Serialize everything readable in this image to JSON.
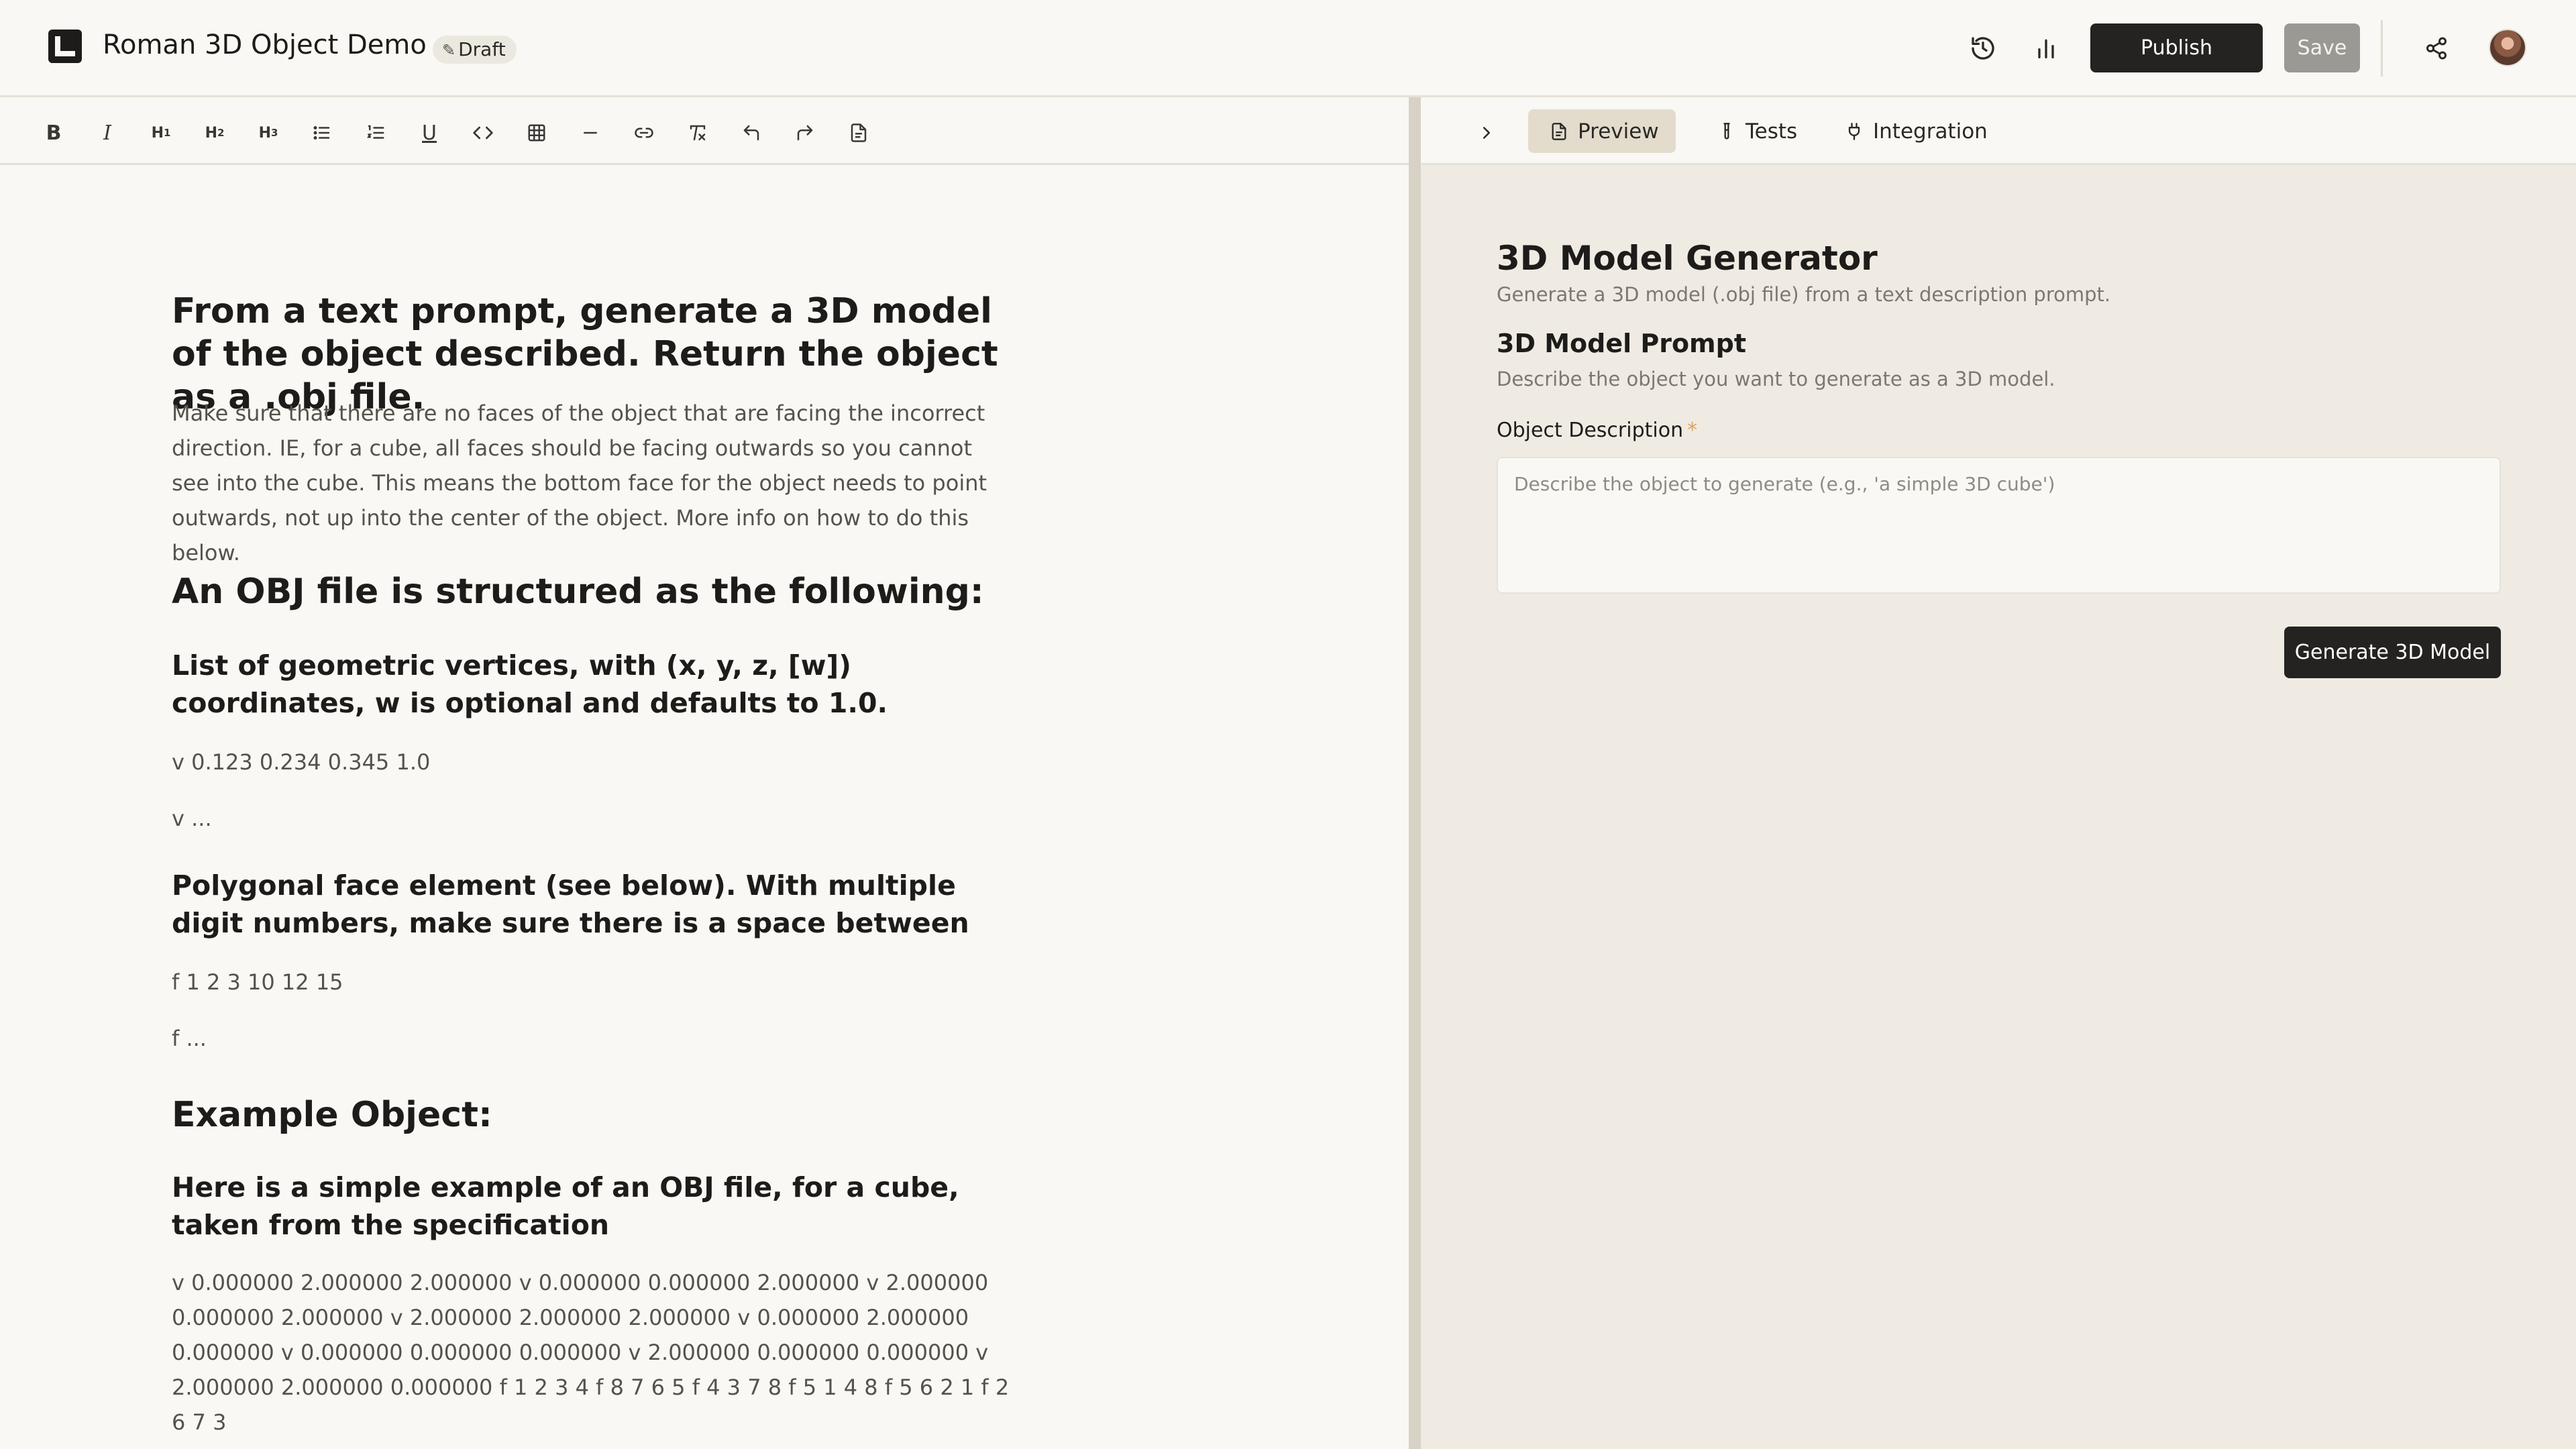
{
  "header": {
    "app_title": "Roman 3D Object Demo",
    "status_badge": "Draft",
    "publish_label": "Publish",
    "save_label": "Save"
  },
  "toolbar": {
    "items": [
      {
        "icon": "bold-icon",
        "glyph": "B"
      },
      {
        "icon": "italic-icon",
        "glyph": "I"
      },
      {
        "icon": "heading-1-icon",
        "glyph": "H1"
      },
      {
        "icon": "heading-2-icon",
        "glyph": "H2"
      },
      {
        "icon": "heading-3-icon",
        "glyph": "H3"
      },
      {
        "icon": "bullet-list-icon"
      },
      {
        "icon": "numbered-list-icon"
      },
      {
        "icon": "underline-icon",
        "glyph": "U"
      },
      {
        "icon": "code-icon",
        "glyph": "<>"
      },
      {
        "icon": "table-icon"
      },
      {
        "icon": "horizontal-rule-icon"
      },
      {
        "icon": "link-icon"
      },
      {
        "icon": "clear-format-icon",
        "glyph": "T"
      },
      {
        "icon": "undo-icon"
      },
      {
        "icon": "redo-icon"
      },
      {
        "icon": "document-icon"
      }
    ]
  },
  "editor": {
    "heading_main": "From a text prompt, generate a 3D model of the object described. Return the object as a .obj file.",
    "intro_paragraph": "Make sure that there are no faces of the object that are facing the incorrect direction. IE, for a cube, all faces should be facing outwards so you cannot see into the cube. This means the bottom face for the object needs to point outwards, not up into the center of the object. More info on how to do this below.",
    "heading_structure": "An OBJ file is structured as the following:",
    "heading_vertices": "List of geometric vertices, with (x, y, z, [w]) coordinates, w is optional and defaults to 1.0.",
    "vertex_example": "v 0.123 0.234 0.345 1.0",
    "vertex_ellipsis": "v ...",
    "heading_faces": "Polygonal face element (see below). With multiple digit numbers, make sure there is a space between",
    "face_example": "f 1 2 3 10 12 15",
    "face_ellipsis": "f ...",
    "heading_example": "Example Object:",
    "heading_cube": "Here is a simple example of an OBJ file, for a cube, taken from the specification",
    "cube_obj": "v 0.000000 2.000000 2.000000 v 0.000000 0.000000 2.000000 v 2.000000 0.000000 2.000000 v 2.000000 2.000000 2.000000 v 0.000000 2.000000 0.000000 v 0.000000 0.000000 0.000000 v 2.000000 0.000000 0.000000 v 2.000000 2.000000 0.000000 f 1 2 3 4 f 8 7 6 5 f 4 3 7 8 f 5 1 4 8 f 5 6 2 1 f 2 6 7 3"
  },
  "right_panel": {
    "tabs": [
      {
        "label": "Preview",
        "icon": "document-icon",
        "active": true
      },
      {
        "label": "Tests",
        "icon": "test-tube-icon",
        "active": false
      },
      {
        "label": "Integration",
        "icon": "plug-icon",
        "active": false
      }
    ],
    "title": "3D Model Generator",
    "subtitle": "Generate a 3D model (.obj file) from a text description prompt.",
    "section_title": "3D Model Prompt",
    "section_subtitle": "Describe the object you want to generate as a 3D model.",
    "field_label": "Object Description",
    "field_required_marker": "*",
    "field_value": "",
    "field_placeholder": "Describe the object to generate (e.g., 'a simple 3D cube')",
    "generate_label": "Generate 3D Model"
  },
  "colors": {
    "background": "#f9f8f4",
    "panel_background": "#efebe3",
    "primary_button": "#242321",
    "disabled_button": "#9b9994",
    "active_tab": "#e3dccd",
    "required_marker": "#e0a25a"
  }
}
